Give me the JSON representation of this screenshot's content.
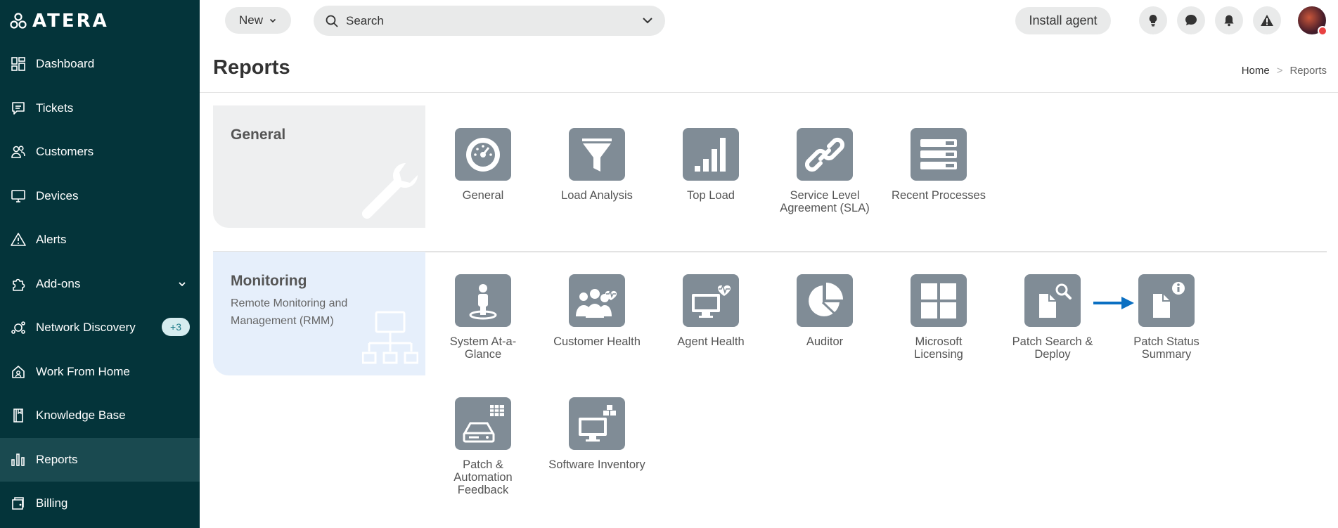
{
  "app": {
    "logo_text": "ATERA"
  },
  "sidebar": {
    "items": [
      {
        "label": "Dashboard",
        "icon": "dashboard-icon"
      },
      {
        "label": "Tickets",
        "icon": "tickets-icon"
      },
      {
        "label": "Customers",
        "icon": "customers-icon"
      },
      {
        "label": "Devices",
        "icon": "devices-icon"
      },
      {
        "label": "Alerts",
        "icon": "alerts-icon"
      },
      {
        "label": "Add-ons",
        "icon": "addons-icon"
      },
      {
        "label": "Network Discovery",
        "icon": "network-discovery-icon",
        "badge": "+3"
      },
      {
        "label": "Work From Home",
        "icon": "home-icon"
      },
      {
        "label": "Knowledge Base",
        "icon": "book-icon"
      },
      {
        "label": "Reports",
        "icon": "reports-icon",
        "active": true
      },
      {
        "label": "Billing",
        "icon": "billing-icon"
      }
    ]
  },
  "topbar": {
    "new_label": "New",
    "search_placeholder": "Search",
    "install_label": "Install agent"
  },
  "page": {
    "title": "Reports",
    "breadcrumb": {
      "home": "Home",
      "separator": ">",
      "current": "Reports"
    }
  },
  "sections": {
    "general": {
      "title": "General",
      "reports": [
        "General",
        "Load Analysis",
        "Top Load",
        "Service Level Agreement (SLA)",
        "Recent Processes"
      ]
    },
    "monitoring": {
      "title": "Monitoring",
      "subtitle": "Remote Monitoring and Management (RMM)",
      "reports": [
        "System At-a-Glance",
        "Customer Health",
        "Agent Health",
        "Auditor",
        "Microsoft Licensing",
        "Patch Search & Deploy",
        "Patch Status Summary",
        "Patch & Automation Feedback",
        "Software Inventory"
      ]
    }
  },
  "colors": {
    "sidebar_bg": "#04343a",
    "sidebar_active": "#1a4a50",
    "tile_gray": "#808c96",
    "arrow_blue": "#0a6fc2",
    "badge_bg": "#d6ecef"
  }
}
